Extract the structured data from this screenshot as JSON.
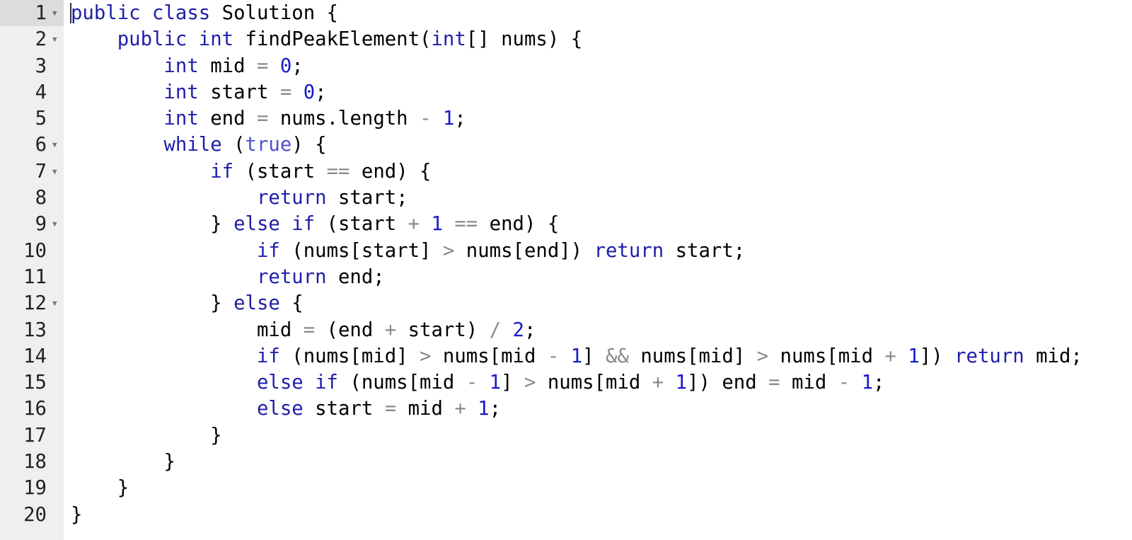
{
  "colors": {
    "keyword": "#1f1fa8",
    "number": "#1818cc",
    "operator": "#8a8a8a",
    "gutter": "#efefef",
    "active_gutter": "#dcdcdc"
  },
  "fold_icon": "caret-down-icon",
  "lines": [
    {
      "n": "1",
      "fold": true,
      "tokens": [
        [
          "k",
          "public class"
        ],
        [
          "t",
          " Solution {"
        ]
      ]
    },
    {
      "n": "2",
      "fold": true,
      "tokens": [
        [
          "t",
          "    "
        ],
        [
          "k",
          "public int"
        ],
        [
          "t",
          " findPeakElement("
        ],
        [
          "k",
          "int"
        ],
        [
          "t",
          "[] nums) {"
        ]
      ]
    },
    {
      "n": "3",
      "fold": false,
      "tokens": [
        [
          "t",
          "        "
        ],
        [
          "k",
          "int"
        ],
        [
          "t",
          " mid "
        ],
        [
          "o",
          "="
        ],
        [
          "t",
          " "
        ],
        [
          "n",
          "0"
        ],
        [
          "t",
          ";"
        ]
      ]
    },
    {
      "n": "4",
      "fold": false,
      "tokens": [
        [
          "t",
          "        "
        ],
        [
          "k",
          "int"
        ],
        [
          "t",
          " start "
        ],
        [
          "o",
          "="
        ],
        [
          "t",
          " "
        ],
        [
          "n",
          "0"
        ],
        [
          "t",
          ";"
        ]
      ]
    },
    {
      "n": "5",
      "fold": false,
      "tokens": [
        [
          "t",
          "        "
        ],
        [
          "k",
          "int"
        ],
        [
          "t",
          " end "
        ],
        [
          "o",
          "="
        ],
        [
          "t",
          " nums.length "
        ],
        [
          "o",
          "-"
        ],
        [
          "t",
          " "
        ],
        [
          "n",
          "1"
        ],
        [
          "t",
          ";"
        ]
      ]
    },
    {
      "n": "6",
      "fold": true,
      "tokens": [
        [
          "t",
          "        "
        ],
        [
          "k",
          "while"
        ],
        [
          "t",
          " ("
        ],
        [
          "b",
          "true"
        ],
        [
          "t",
          ") {"
        ]
      ]
    },
    {
      "n": "7",
      "fold": true,
      "tokens": [
        [
          "t",
          "            "
        ],
        [
          "k",
          "if"
        ],
        [
          "t",
          " (start "
        ],
        [
          "o",
          "=="
        ],
        [
          "t",
          " end) {"
        ]
      ]
    },
    {
      "n": "8",
      "fold": false,
      "tokens": [
        [
          "t",
          "                "
        ],
        [
          "k",
          "return"
        ],
        [
          "t",
          " start;"
        ]
      ]
    },
    {
      "n": "9",
      "fold": true,
      "tokens": [
        [
          "t",
          "            } "
        ],
        [
          "k",
          "else if"
        ],
        [
          "t",
          " (start "
        ],
        [
          "o",
          "+"
        ],
        [
          "t",
          " "
        ],
        [
          "n",
          "1"
        ],
        [
          "t",
          " "
        ],
        [
          "o",
          "=="
        ],
        [
          "t",
          " end) {"
        ]
      ]
    },
    {
      "n": "10",
      "fold": false,
      "tokens": [
        [
          "t",
          "                "
        ],
        [
          "k",
          "if"
        ],
        [
          "t",
          " (nums[start] "
        ],
        [
          "o",
          ">"
        ],
        [
          "t",
          " nums[end]) "
        ],
        [
          "k",
          "return"
        ],
        [
          "t",
          " start;"
        ]
      ]
    },
    {
      "n": "11",
      "fold": false,
      "tokens": [
        [
          "t",
          "                "
        ],
        [
          "k",
          "return"
        ],
        [
          "t",
          " end;"
        ]
      ]
    },
    {
      "n": "12",
      "fold": true,
      "tokens": [
        [
          "t",
          "            } "
        ],
        [
          "k",
          "else"
        ],
        [
          "t",
          " {"
        ]
      ]
    },
    {
      "n": "13",
      "fold": false,
      "tokens": [
        [
          "t",
          "                mid "
        ],
        [
          "o",
          "="
        ],
        [
          "t",
          " (end "
        ],
        [
          "o",
          "+"
        ],
        [
          "t",
          " start) "
        ],
        [
          "o",
          "/"
        ],
        [
          "t",
          " "
        ],
        [
          "n",
          "2"
        ],
        [
          "t",
          ";"
        ]
      ]
    },
    {
      "n": "14",
      "fold": false,
      "tokens": [
        [
          "t",
          "                "
        ],
        [
          "k",
          "if"
        ],
        [
          "t",
          " (nums[mid] "
        ],
        [
          "o",
          ">"
        ],
        [
          "t",
          " nums[mid "
        ],
        [
          "o",
          "-"
        ],
        [
          "t",
          " "
        ],
        [
          "n",
          "1"
        ],
        [
          "t",
          "] "
        ],
        [
          "o",
          "&&"
        ],
        [
          "t",
          " nums[mid] "
        ],
        [
          "o",
          ">"
        ],
        [
          "t",
          " nums[mid "
        ],
        [
          "o",
          "+"
        ],
        [
          "t",
          " "
        ],
        [
          "n",
          "1"
        ],
        [
          "t",
          "]) "
        ],
        [
          "k",
          "return"
        ],
        [
          "t",
          " mid;"
        ]
      ]
    },
    {
      "n": "15",
      "fold": false,
      "tokens": [
        [
          "t",
          "                "
        ],
        [
          "k",
          "else if"
        ],
        [
          "t",
          " (nums[mid "
        ],
        [
          "o",
          "-"
        ],
        [
          "t",
          " "
        ],
        [
          "n",
          "1"
        ],
        [
          "t",
          "] "
        ],
        [
          "o",
          ">"
        ],
        [
          "t",
          " nums[mid "
        ],
        [
          "o",
          "+"
        ],
        [
          "t",
          " "
        ],
        [
          "n",
          "1"
        ],
        [
          "t",
          "]) end "
        ],
        [
          "o",
          "="
        ],
        [
          "t",
          " mid "
        ],
        [
          "o",
          "-"
        ],
        [
          "t",
          " "
        ],
        [
          "n",
          "1"
        ],
        [
          "t",
          ";"
        ]
      ]
    },
    {
      "n": "16",
      "fold": false,
      "tokens": [
        [
          "t",
          "                "
        ],
        [
          "k",
          "else"
        ],
        [
          "t",
          " start "
        ],
        [
          "o",
          "="
        ],
        [
          "t",
          " mid "
        ],
        [
          "o",
          "+"
        ],
        [
          "t",
          " "
        ],
        [
          "n",
          "1"
        ],
        [
          "t",
          ";"
        ]
      ]
    },
    {
      "n": "17",
      "fold": false,
      "tokens": [
        [
          "t",
          "            }"
        ]
      ]
    },
    {
      "n": "18",
      "fold": false,
      "tokens": [
        [
          "t",
          "        }"
        ]
      ]
    },
    {
      "n": "19",
      "fold": false,
      "tokens": [
        [
          "t",
          "    }"
        ]
      ]
    },
    {
      "n": "20",
      "fold": false,
      "tokens": [
        [
          "t",
          "}"
        ]
      ]
    }
  ]
}
